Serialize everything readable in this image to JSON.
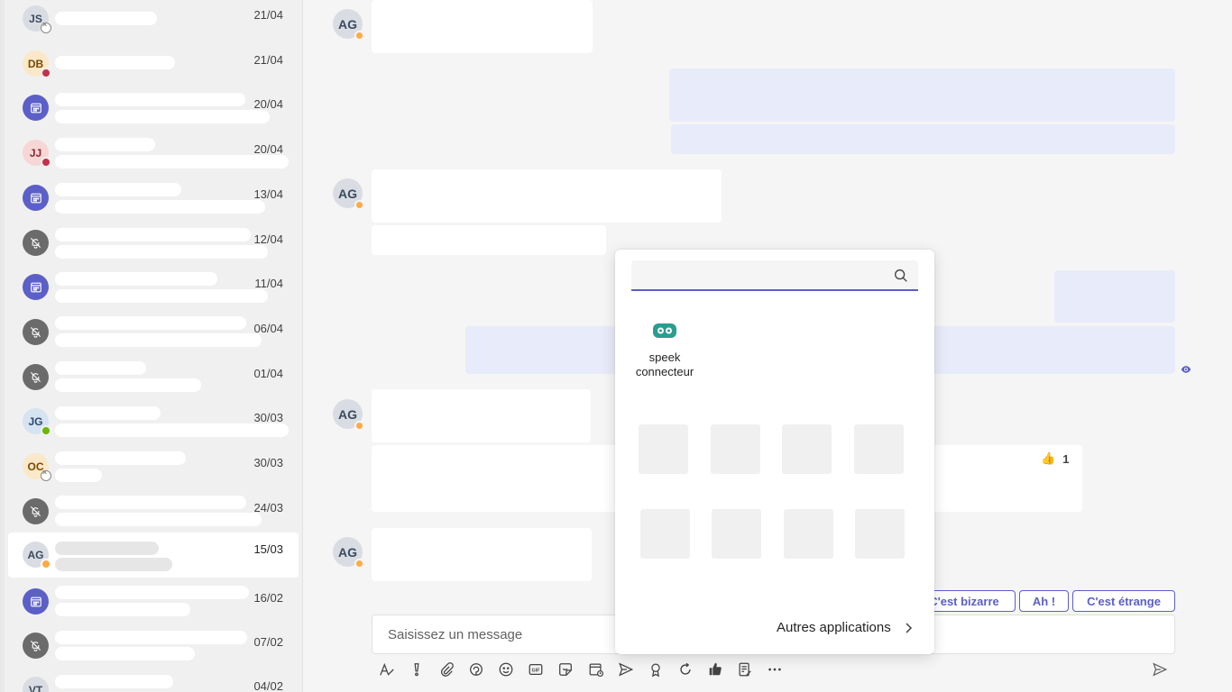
{
  "sidebar": {
    "chats": [
      {
        "initials": "JS",
        "date": "21/04"
      },
      {
        "initials": "DB",
        "date": "21/04"
      },
      {
        "initials": "",
        "icon": "calendar-icon",
        "date": "20/04"
      },
      {
        "initials": "JJ",
        "date": "20/04"
      },
      {
        "initials": "",
        "icon": "calendar-icon",
        "date": "13/04"
      },
      {
        "initials": "",
        "icon": "muted-bell-icon",
        "date": "12/04"
      },
      {
        "initials": "",
        "icon": "calendar-icon",
        "date": "11/04"
      },
      {
        "initials": "",
        "icon": "muted-bell-icon",
        "date": "06/04"
      },
      {
        "initials": "",
        "icon": "muted-bell-icon",
        "date": "01/04"
      },
      {
        "initials": "JG",
        "date": "30/03"
      },
      {
        "initials": "OC",
        "date": "30/03"
      },
      {
        "initials": "",
        "icon": "muted-bell-icon",
        "date": "24/03"
      },
      {
        "initials": "AG",
        "date": "15/03",
        "active": true
      },
      {
        "initials": "",
        "icon": "calendar-icon",
        "date": "16/02"
      },
      {
        "initials": "",
        "icon": "muted-bell-icon",
        "date": "07/02"
      },
      {
        "initials": "VT",
        "date": "04/02"
      }
    ]
  },
  "conversation": {
    "sender_initials": "AG",
    "reaction": {
      "emoji": "👍",
      "count": "1"
    }
  },
  "suggested_replies": [
    "C'est bizarre",
    "Ah !",
    "C'est étrange"
  ],
  "compose": {
    "placeholder": "Saisissez un message"
  },
  "toolbar": {
    "icons": [
      "format-icon",
      "important-icon",
      "attach-icon",
      "loop-icon",
      "emoji-icon",
      "gif-icon",
      "sticker-icon",
      "schedule-meeting-icon",
      "send-later-icon",
      "praise-icon",
      "refresh-icon",
      "approvals-icon",
      "notes-icon",
      "more-options-icon"
    ]
  },
  "app_picker": {
    "search_placeholder": "",
    "apps": [
      {
        "name": "speek connecteur",
        "icon": "speek-icon",
        "accent": "#2a9d8f"
      }
    ],
    "more_apps_label": "Autres applications"
  },
  "colors": {
    "accent": "#5b5fc7",
    "bubble_me": "#e8ebfa"
  }
}
